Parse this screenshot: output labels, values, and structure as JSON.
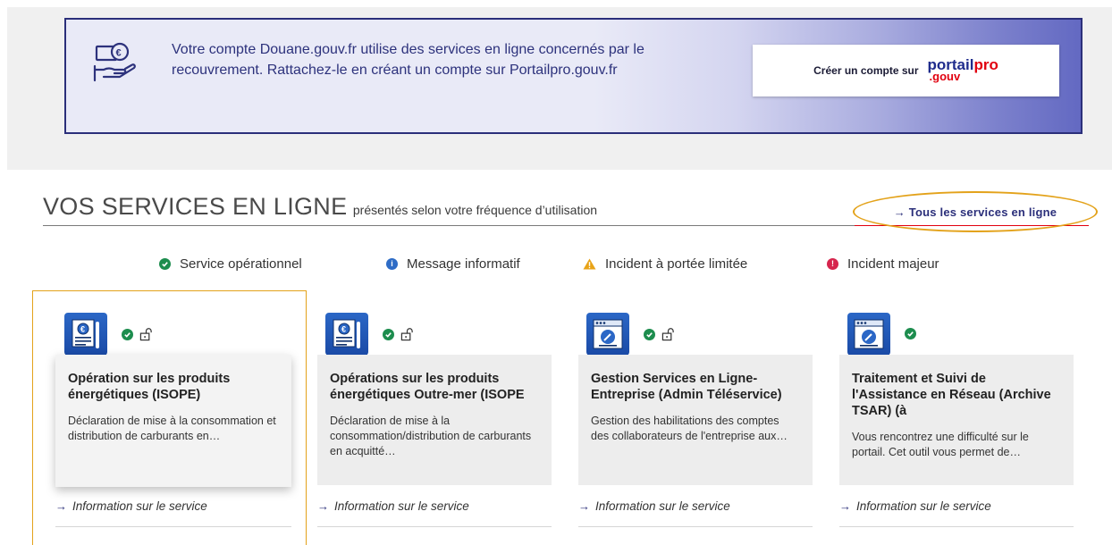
{
  "banner": {
    "text": "Votre compte Douane.gouv.fr utilise des services en ligne concernés par le recouvrement. Rattachez-le en créant un compte sur Portailpro.gouv.fr",
    "button_label": "Créer un compte sur",
    "logo_line1_a": "portail",
    "logo_line1_b": "pro",
    "logo_line2": ".gouv",
    "icon": "hand-coin-icon",
    "border_color": "#2b2f7a"
  },
  "services": {
    "title": "VOS SERVICES EN LIGNE",
    "subtitle": "présentés selon votre fréquence d’utilisation",
    "all_link": "→ Tous les services en ligne"
  },
  "legend": [
    {
      "label": "Service opérationnel",
      "color": "#1d8d4e",
      "icon": "check-circle-icon"
    },
    {
      "label": "Message informatif",
      "color": "#2e6cc6",
      "icon": "info-circle-icon"
    },
    {
      "label": "Incident à portée limitée",
      "color": "#e8a317",
      "icon": "warning-triangle-icon"
    },
    {
      "label": "Incident majeur",
      "color": "#d6254d",
      "icon": "alert-circle-icon"
    }
  ],
  "cards": [
    {
      "title": "Opération sur les produits énergétiques (ISOPE)",
      "description": "Déclaration de mise à la consommation et distribution de carburants en…",
      "link": "Information sur le service",
      "icon": "document-coin-icon"
    },
    {
      "title": "Opérations sur les produits énergétiques Outre-mer (ISOPE",
      "description": "Déclaration de mise à la consommation/distribution de carburants en acquitté…",
      "link": "Information sur le service",
      "icon": "document-coin-icon"
    },
    {
      "title": "Gestion Services en Ligne- Entreprise (Admin Téléservice)",
      "description": "Gestion des habilitations des comptes des collaborateurs de l'entreprise aux…",
      "link": "Information sur le service",
      "icon": "browser-window-icon"
    },
    {
      "title": "Traitement et Suivi de l'Assistance en Réseau (Archive TSAR) (à",
      "description": "Vous rencontrez une difficulté sur le portail. Cet outil vous permet de…",
      "link": "Information sur le service",
      "icon": "browser-window-icon"
    }
  ],
  "colors": {
    "accent_navy": "#2b2f7a",
    "highlight_orange": "#e3a21a",
    "red": "#e1000f",
    "ok_green": "#1d8d4e"
  }
}
